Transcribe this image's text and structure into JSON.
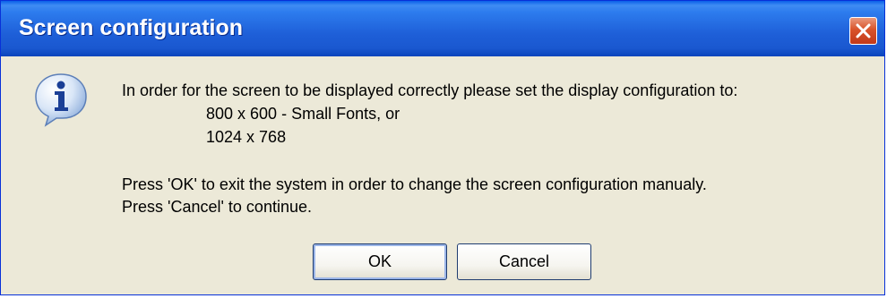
{
  "window": {
    "title": "Screen configuration"
  },
  "icon": {
    "name": "info-icon",
    "glyph": "i"
  },
  "message": {
    "line1": "In order for the screen to be displayed correctly please set the display configuration to:",
    "option1": "800 x 600 - Small Fonts, or",
    "option2": "1024 x 768",
    "line2": "Press 'OK' to exit the system in order to change the screen configuration manualy.",
    "line3": "Press 'Cancel' to continue."
  },
  "buttons": {
    "ok": "OK",
    "cancel": "Cancel"
  },
  "colors": {
    "titlebar": "#1E5FD8",
    "dialog_bg": "#ECE9D8",
    "close_button": "#D9532A"
  }
}
